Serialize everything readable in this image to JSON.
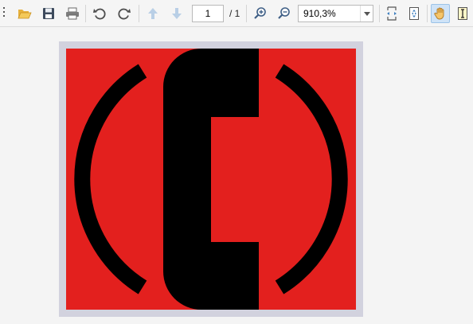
{
  "toolbar": {
    "buttons": [
      {
        "name": "open",
        "icon": "folder-open-icon"
      },
      {
        "name": "save",
        "icon": "save-icon"
      },
      {
        "name": "print",
        "icon": "printer-icon"
      },
      {
        "name": "rotate-left",
        "icon": "rotate-ccw-icon"
      },
      {
        "name": "rotate-right",
        "icon": "rotate-cw-icon"
      },
      {
        "name": "previous-page",
        "icon": "arrow-up-icon"
      },
      {
        "name": "next-page",
        "icon": "arrow-down-icon"
      },
      {
        "name": "zoom-in",
        "icon": "zoom-in-icon"
      },
      {
        "name": "zoom-out",
        "icon": "zoom-out-icon"
      },
      {
        "name": "fit-width",
        "icon": "fit-width-icon"
      },
      {
        "name": "fit-page",
        "icon": "fit-page-icon"
      },
      {
        "name": "pan-tool",
        "icon": "hand-icon",
        "active": true
      },
      {
        "name": "text-select",
        "icon": "text-select-icon"
      }
    ],
    "page_number": "1",
    "page_total": "/ 1",
    "zoom": "910,3%"
  },
  "document": {
    "image_icon": "telephone-handset-icon",
    "colors": {
      "page_border": "#d2d2de",
      "background": "#e3201e",
      "foreground": "#000000"
    }
  },
  "colors": {
    "toolbar_bg": "#f5f5f5",
    "workspace_bg": "#f4f4f4",
    "active_button_bg": "#cfe3f7"
  }
}
